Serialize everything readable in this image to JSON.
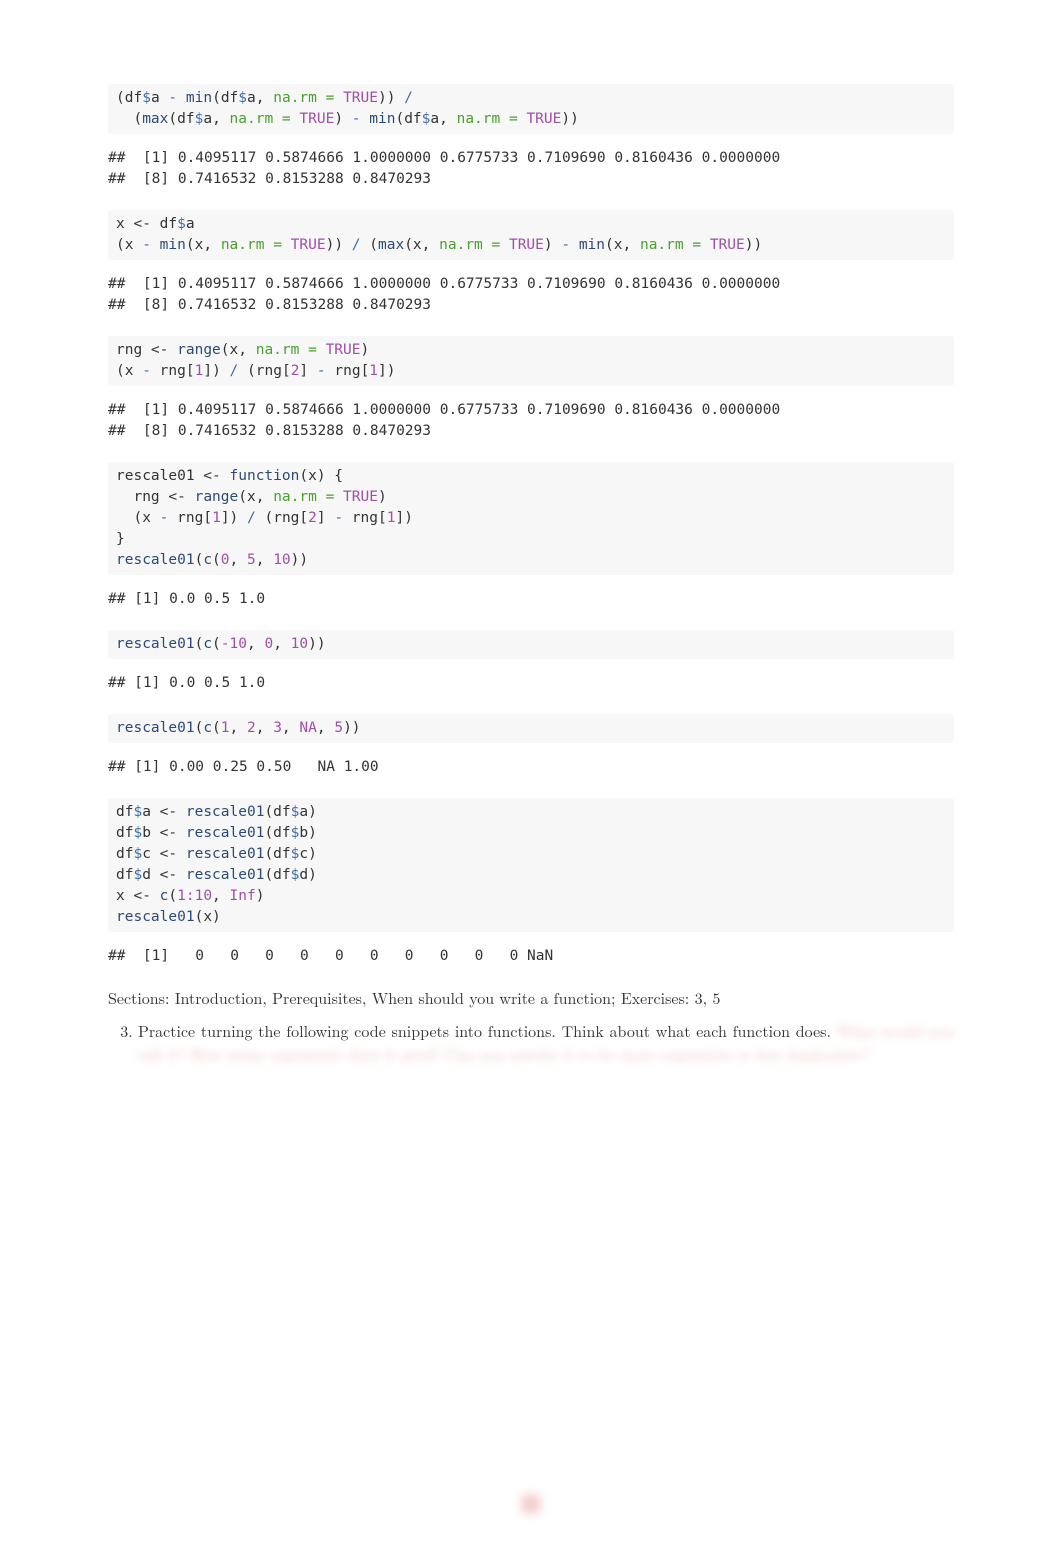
{
  "code": {
    "block1_l1": "(df$a - min(df$a, na.rm = TRUE)) /",
    "block1_l2": "  (max(df$a, na.rm = TRUE) - min(df$a, na.rm = TRUE))",
    "out1_l1": "##  [1] 0.4095117 0.5874666 1.0000000 0.6775733 0.7109690 0.8160436 0.0000000",
    "out1_l2": "##  [8] 0.7416532 0.8153288 0.8470293",
    "block2_l1": "x <- df$a",
    "block2_l2": "(x - min(x, na.rm = TRUE)) / (max(x, na.rm = TRUE) - min(x, na.rm = TRUE))",
    "out2_l1": "##  [1] 0.4095117 0.5874666 1.0000000 0.6775733 0.7109690 0.8160436 0.0000000",
    "out2_l2": "##  [8] 0.7416532 0.8153288 0.8470293",
    "block3_l1": "rng <- range(x, na.rm = TRUE)",
    "block3_l2": "(x - rng[1]) / (rng[2] - rng[1])",
    "out3_l1": "##  [1] 0.4095117 0.5874666 1.0000000 0.6775733 0.7109690 0.8160436 0.0000000",
    "out3_l2": "##  [8] 0.7416532 0.8153288 0.8470293",
    "block4_l1": "rescale01 <- function(x) {",
    "block4_l2": "  rng <- range(x, na.rm = TRUE)",
    "block4_l3": "  (x - rng[1]) / (rng[2] - rng[1])",
    "block4_l4": "}",
    "block4_l5": "rescale01(c(0, 5, 10))",
    "out4": "## [1] 0.0 0.5 1.0",
    "block5": "rescale01(c(-10, 0, 10))",
    "out5": "## [1] 0.0 0.5 1.0",
    "block6": "rescale01(c(1, 2, 3, NA, 5))",
    "out6": "## [1] 0.00 0.25 0.50   NA 1.00",
    "block7_l1": "df$a <- rescale01(df$a)",
    "block7_l2": "df$b <- rescale01(df$b)",
    "block7_l3": "df$c <- rescale01(df$c)",
    "block7_l4": "df$d <- rescale01(df$d)",
    "block7_l5": "x <- c(1:10, Inf)",
    "block7_l6": "rescale01(x)",
    "out7": "##  [1]   0   0   0   0   0   0   0   0   0   0 NaN"
  },
  "tokens": {
    "df": "df",
    "dollar": "$",
    "a": "a",
    "b": "b",
    "c_col": "c",
    "d": "d",
    "minus": " - ",
    "slash": " / ",
    "slash_end": " /",
    "min": "min",
    "max": "max",
    "range": "range",
    "function": "function",
    "rescale01": "rescale01",
    "c_fn": "c",
    "lp": "(",
    "rp": ")",
    "lb": "{",
    "rb": "}",
    "comma": ", ",
    "na_rm": "na.rm = ",
    "TRUE": "TRUE",
    "NA": "NA",
    "Inf": "Inf",
    "x": "x",
    "rng": "rng",
    "assign": " <- ",
    "sq1": "[",
    "sq2": "]",
    "n0": "0",
    "n1": "1",
    "n2": "2",
    "n3": "3",
    "n5": "5",
    "n10": "10",
    "nm10": "-10",
    "r1_10": "1:10",
    "ind2": "  "
  },
  "prose": {
    "sections": "Sections: Introduction, Prerequisites, When should you write a function; Exercises: 3, 5",
    "ex3": "Practice turning the following code snippets into functions. Think about what each function does.",
    "ex3_hidden": "What would you call it? How many arguments does it need? Can you rewrite it to be more expressive or less duplicative?"
  }
}
